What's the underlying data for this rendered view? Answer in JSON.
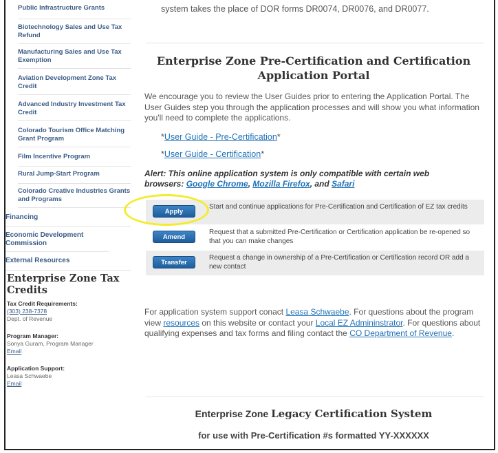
{
  "sidebar": {
    "sub_items": [
      {
        "label": "Public Infrastructure Grants"
      },
      {
        "label": "Biotechnology Sales and Use Tax Refund"
      },
      {
        "label": "Manufacturing Sales and Use Tax Exemption"
      },
      {
        "label": "Aviation Development Zone Tax Credit"
      },
      {
        "label": "Advanced Industry Investment Tax Credit"
      },
      {
        "label": "Colorado Tourism Office Matching Grant Program"
      },
      {
        "label": "Film Incentive Program"
      },
      {
        "label": "Rural Jump-Start Program"
      },
      {
        "label": "Colorado Creative Industries Grants and Programs"
      }
    ],
    "top_items": [
      {
        "label": "Financing"
      },
      {
        "label": "Economic Development Commission"
      },
      {
        "label": "External Resources"
      }
    ],
    "section_title": "Enterprise Zone Tax Credits",
    "contacts": {
      "tax_heading": "Tax Credit Requirements:",
      "tax_phone": "(303) 238-7378",
      "tax_dept": "Dept. of Revenue",
      "pm_heading": "Program Manager:",
      "pm_name": "Sonya Guram, Program Manager",
      "pm_email": "Email",
      "support_heading": "Application Support:",
      "support_name": "Leasa Schwaebe",
      "support_email": "Email"
    }
  },
  "main": {
    "top_text": "system takes the place of DOR forms DR0074, DR0076, and DR0077.",
    "portal_title": "Enterprise Zone Pre-Certification and Certification Application Portal",
    "intro": "We encourage you to review the User Guides prior to entering the Application Portal. The User Guides step you through the application processes and will show you what information you'll need to complete the applications.",
    "guide1": {
      "pre": "*",
      "link": "User Guide - Pre-Certification",
      "post": "*"
    },
    "guide2": {
      "pre": "*",
      "link": "User Guide - Certification",
      "post": "*"
    },
    "alert": {
      "text": "Alert: This online application system is only compatible with certain web browsers: ",
      "chrome": "Google Chrome",
      "sep1": ", ",
      "firefox": "Mozilla Firefox",
      "sep2": ", and ",
      "safari": "Safari"
    },
    "actions": [
      {
        "button": "Apply",
        "desc": "Start and continue applications for Pre-Certification and Certification of EZ tax credits"
      },
      {
        "button": "Amend",
        "desc": "Request that a submitted Pre-Certification or Certification application be re-opened so that you can make changes"
      },
      {
        "button": "Transfer",
        "desc": "Request a change in ownership of a Pre-Certification or Certification record OR add a new contact"
      }
    ],
    "support": {
      "t1": "For application system support conact ",
      "l1": "Leasa Schwaebe",
      "t2": ". For questions about the program view ",
      "l2": "resources",
      "t3": " on this website or contact your ",
      "l3": "Local EZ Admininstrator",
      "t4": ". For questions about qualifying expenses and tax forms and filing contact the ",
      "l4": "CO Department of Revenue",
      "t5": "."
    },
    "legacy": {
      "pre": "Enterprise Zone ",
      "title": "Legacy Certification System",
      "sub": "for use with Pre-Certification #s formatted YY-XXXXXX"
    }
  },
  "colors": {
    "link": "#1f72b8",
    "nav": "#3b5c86",
    "button": "#1e5d9c",
    "highlight": "#f4ec2a"
  }
}
